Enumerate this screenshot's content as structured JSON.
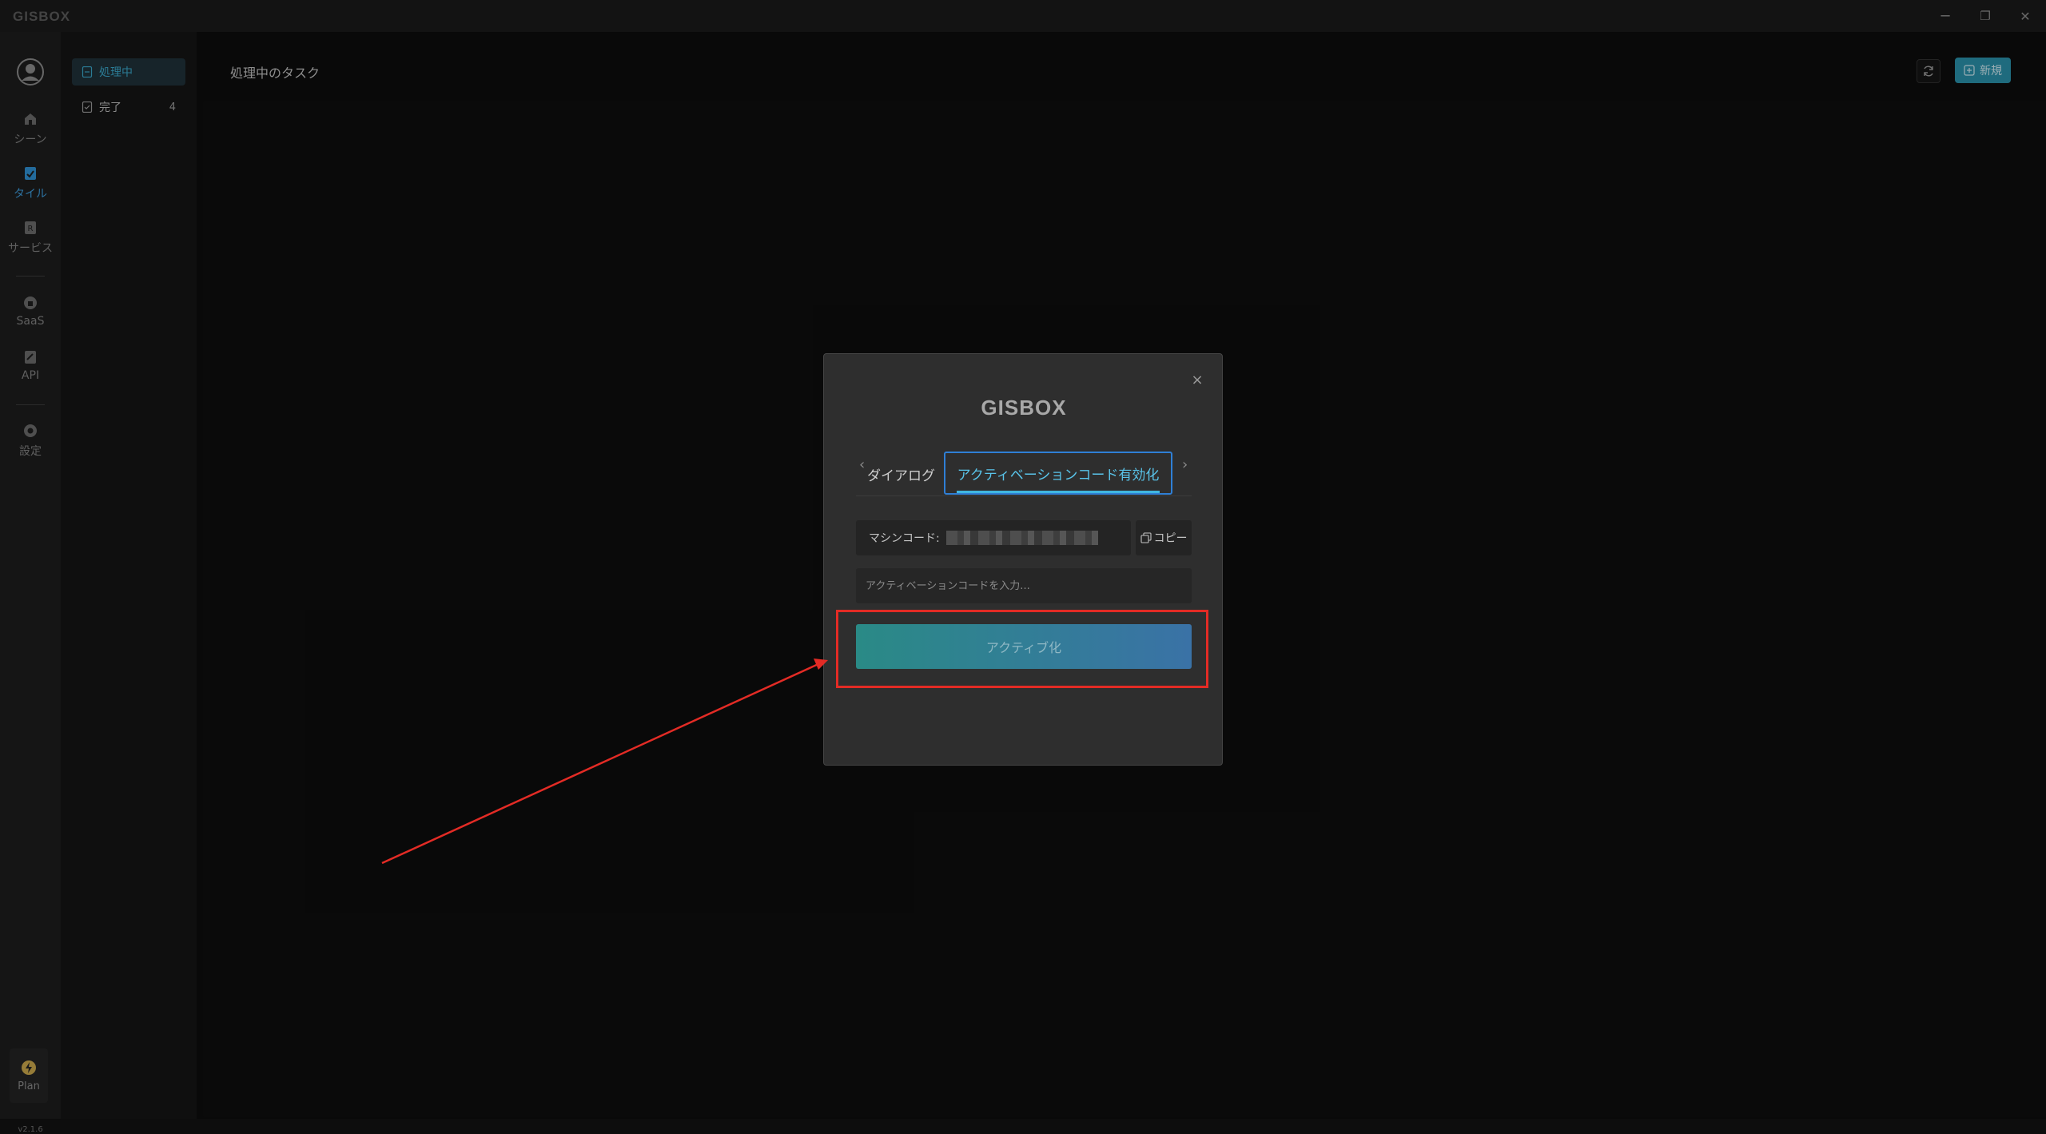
{
  "titlebar": {
    "logo": "GISBOX",
    "minimize": "─",
    "restore": "❐",
    "close": "✕"
  },
  "rail": {
    "items": [
      {
        "label": "シーン",
        "icon": "home-icon"
      },
      {
        "label": "タイル",
        "icon": "tile-icon"
      },
      {
        "label": "サービス",
        "icon": "service-icon"
      },
      {
        "label": "SaaS",
        "icon": "cloud-icon"
      },
      {
        "label": "API",
        "icon": "api-icon"
      },
      {
        "label": "設定",
        "icon": "gear-icon"
      }
    ],
    "active_index": 1,
    "plan_label": "Plan",
    "version": "v2.1.6"
  },
  "subside": {
    "items": [
      {
        "label": "処理中",
        "count": ""
      },
      {
        "label": "完了",
        "count": "4"
      }
    ]
  },
  "main": {
    "title": "処理中のタスク",
    "new_button": "新規"
  },
  "modal": {
    "logo": "GISBOX",
    "close": "×",
    "tab_prev_label": "ダイアログ",
    "tab_active_label": "アクティベーションコード有効化",
    "machine_code_label": "マシンコード:",
    "copy_label": "コピー",
    "input_placeholder": "アクティベーションコードを入力...",
    "activate_label": "アクティブ化"
  },
  "colors": {
    "accent": "#3aa6c9",
    "highlight": "#e32b25",
    "tab_border": "#2f7fd6"
  }
}
